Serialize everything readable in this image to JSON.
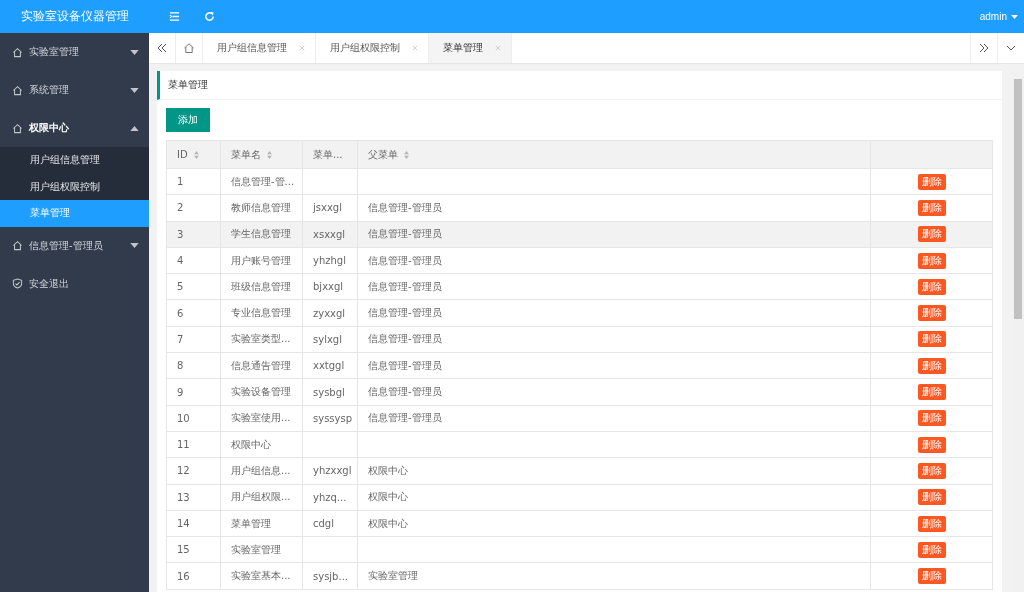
{
  "app_title": "实验室设备仪器管理",
  "header": {
    "user": "admin"
  },
  "sidebar": {
    "items": [
      {
        "label": "实验室管理",
        "kind": "group",
        "expanded": false
      },
      {
        "label": "系统管理",
        "kind": "group",
        "expanded": false
      },
      {
        "label": "权限中心",
        "kind": "group",
        "expanded": true,
        "children": [
          {
            "label": "用户组信息管理",
            "selected": false
          },
          {
            "label": "用户组权限控制",
            "selected": false
          },
          {
            "label": "菜单管理",
            "selected": true
          }
        ]
      },
      {
        "label": "信息管理-管理员",
        "kind": "group",
        "expanded": false
      },
      {
        "label": "安全退出",
        "kind": "logout"
      }
    ]
  },
  "tabs": [
    {
      "label": "用户组信息管理",
      "selected": false
    },
    {
      "label": "用户组权限控制",
      "selected": false
    },
    {
      "label": "菜单管理",
      "selected": true
    }
  ],
  "panel": {
    "title": "菜单管理",
    "add_button": "添加"
  },
  "table": {
    "columns": [
      {
        "label": "ID",
        "sortable": true
      },
      {
        "label": "菜单名",
        "sortable": true
      },
      {
        "label": "菜单...",
        "sortable": false
      },
      {
        "label": "父菜单",
        "sortable": true
      }
    ],
    "rows": [
      {
        "cells": [
          "1",
          "信息管理-管...",
          "",
          ""
        ],
        "selected": false,
        "action": "删除"
      },
      {
        "cells": [
          "2",
          "教师信息管理",
          "jsxxgl",
          "信息管理-管理员"
        ],
        "selected": false,
        "action": "删除"
      },
      {
        "cells": [
          "3",
          "学生信息管理",
          "xsxxgl",
          "信息管理-管理员"
        ],
        "selected": true,
        "action": "删除"
      },
      {
        "cells": [
          "4",
          "用户账号管理",
          "yhzhgl",
          "信息管理-管理员"
        ],
        "selected": false,
        "action": "删除"
      },
      {
        "cells": [
          "5",
          "班级信息管理",
          "bjxxgl",
          "信息管理-管理员"
        ],
        "selected": false,
        "action": "删除"
      },
      {
        "cells": [
          "6",
          "专业信息管理",
          "zyxxgl",
          "信息管理-管理员"
        ],
        "selected": false,
        "action": "删除"
      },
      {
        "cells": [
          "7",
          "实验室类型...",
          "sylxgl",
          "信息管理-管理员"
        ],
        "selected": false,
        "action": "删除"
      },
      {
        "cells": [
          "8",
          "信息通告管理",
          "xxtggl",
          "信息管理-管理员"
        ],
        "selected": false,
        "action": "删除"
      },
      {
        "cells": [
          "9",
          "实验设备管理",
          "sysbgl",
          "信息管理-管理员"
        ],
        "selected": false,
        "action": "删除"
      },
      {
        "cells": [
          "10",
          "实验室使用...",
          "syssysp",
          "信息管理-管理员"
        ],
        "selected": false,
        "action": "删除"
      },
      {
        "cells": [
          "11",
          "权限中心",
          "",
          ""
        ],
        "selected": false,
        "action": "删除"
      },
      {
        "cells": [
          "12",
          "用户组信息...",
          "yhzxxgl",
          "权限中心"
        ],
        "selected": false,
        "action": "删除"
      },
      {
        "cells": [
          "13",
          "用户组权限...",
          "yhzq...",
          "权限中心"
        ],
        "selected": false,
        "action": "删除"
      },
      {
        "cells": [
          "14",
          "菜单管理",
          "cdgl",
          "权限中心"
        ],
        "selected": false,
        "action": "删除"
      },
      {
        "cells": [
          "15",
          "实验室管理",
          "",
          ""
        ],
        "selected": false,
        "action": "删除"
      },
      {
        "cells": [
          "16",
          "实验室基本...",
          "sysjb...",
          "实验室管理"
        ],
        "selected": false,
        "action": "删除"
      }
    ]
  }
}
